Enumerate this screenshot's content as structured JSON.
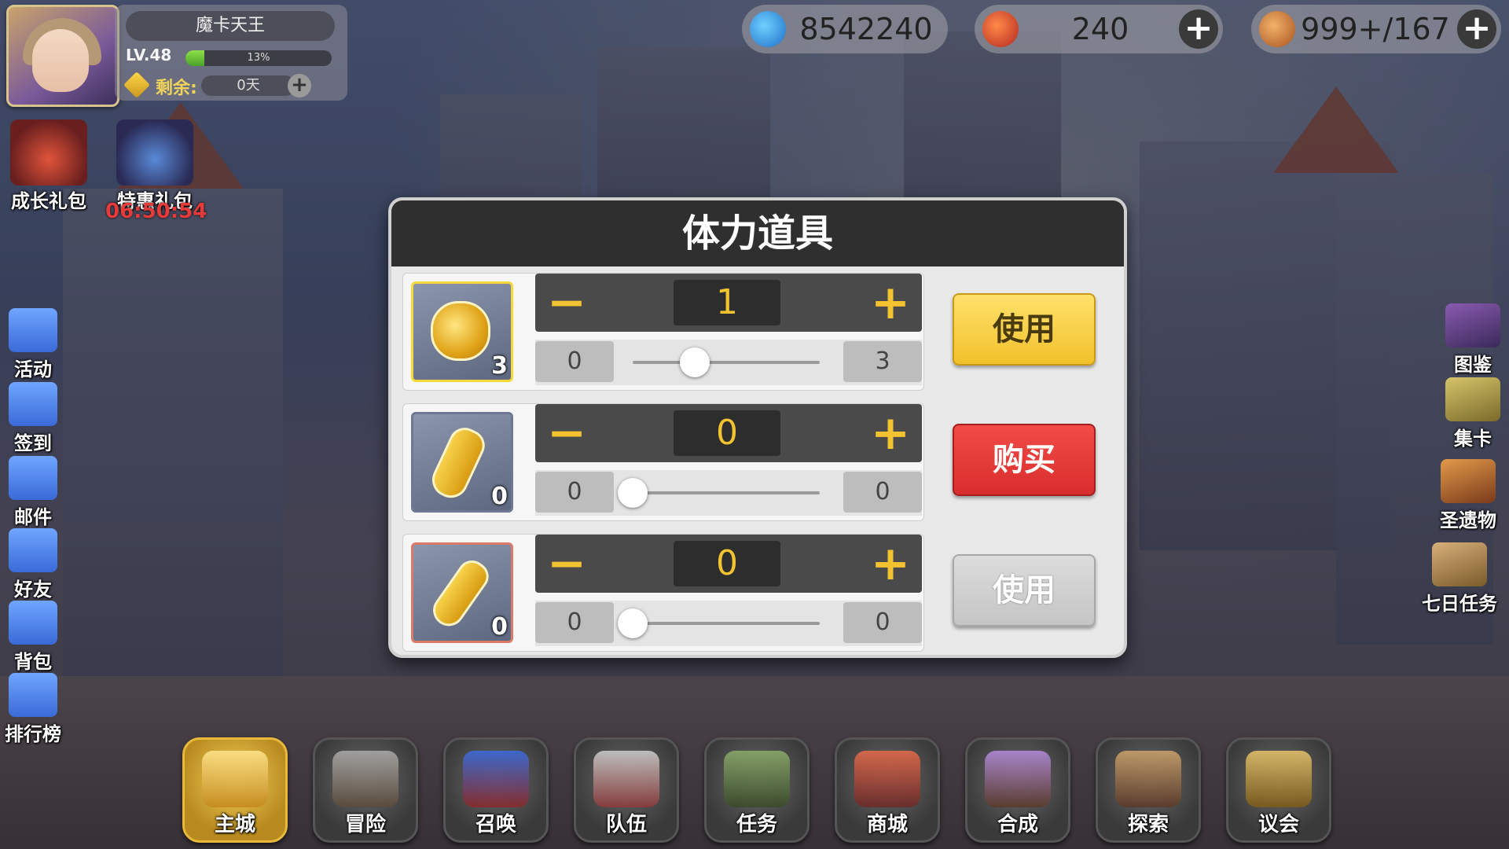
{
  "player": {
    "name": "魔卡天王",
    "level": "LV.48",
    "exp_percent_text": "13%",
    "exp_fraction": 0.13,
    "remain_label": "剩余:",
    "remain_value": "0天",
    "remain_plus": "+"
  },
  "currencies": [
    {
      "icon": "blue-crystal-icon",
      "value": "8542240"
    },
    {
      "icon": "red-gem-icon",
      "value": "240",
      "plus": "+"
    },
    {
      "icon": "food-stamina-icon",
      "value": "999+/167",
      "plus": "+"
    }
  ],
  "gifts": {
    "growth_label": "成长礼包",
    "special_label": "特惠礼包",
    "timer": "06:50:54"
  },
  "left_menu": [
    {
      "icon": "megaphone-icon",
      "label": "活动"
    },
    {
      "icon": "checkin-icon",
      "label": "签到"
    },
    {
      "icon": "mail-icon",
      "label": "邮件"
    },
    {
      "icon": "friends-icon",
      "label": "好友"
    },
    {
      "icon": "backpack-icon",
      "label": "背包"
    },
    {
      "icon": "ranking-icon",
      "label": "排行榜"
    }
  ],
  "right_menu": [
    {
      "icon": "book-icon",
      "label": "图鉴"
    },
    {
      "icon": "card-collect-icon",
      "label": "集卡"
    },
    {
      "icon": "relic-icon",
      "label": "圣遗物"
    },
    {
      "icon": "scroll-quest-icon",
      "label": "七日任务"
    }
  ],
  "bottom_nav": [
    {
      "icon": "crown-icon",
      "label": "主城",
      "active": true
    },
    {
      "icon": "swords-icon",
      "label": "冒险"
    },
    {
      "icon": "summon-card-icon",
      "label": "召唤"
    },
    {
      "icon": "team-wings-icon",
      "label": "队伍"
    },
    {
      "icon": "task-book-icon",
      "label": "任务"
    },
    {
      "icon": "shop-mushroom-icon",
      "label": "商城"
    },
    {
      "icon": "potion-craft-icon",
      "label": "合成"
    },
    {
      "icon": "explore-compass-icon",
      "label": "探索"
    },
    {
      "icon": "council-helmet-icon",
      "label": "议会"
    }
  ],
  "modal": {
    "title": "体力道具",
    "rows": [
      {
        "item_icon": "gold-potion-large-icon",
        "count": "3",
        "quantity": "1",
        "min": "0",
        "max": "3",
        "slider_fraction": 0.33,
        "action": "使用",
        "action_style": "yellow",
        "minus": "−",
        "plus": "+"
      },
      {
        "item_icon": "gold-potion-medium-icon",
        "count": "0",
        "quantity": "0",
        "min": "0",
        "max": "0",
        "slider_fraction": 0,
        "action": "购买",
        "action_style": "red",
        "minus": "−",
        "plus": "+"
      },
      {
        "item_icon": "gold-potion-small-icon",
        "count": "0",
        "quantity": "0",
        "min": "0",
        "max": "0",
        "slider_fraction": 0,
        "action": "使用",
        "action_style": "gray",
        "minus": "−",
        "plus": "+"
      }
    ]
  }
}
